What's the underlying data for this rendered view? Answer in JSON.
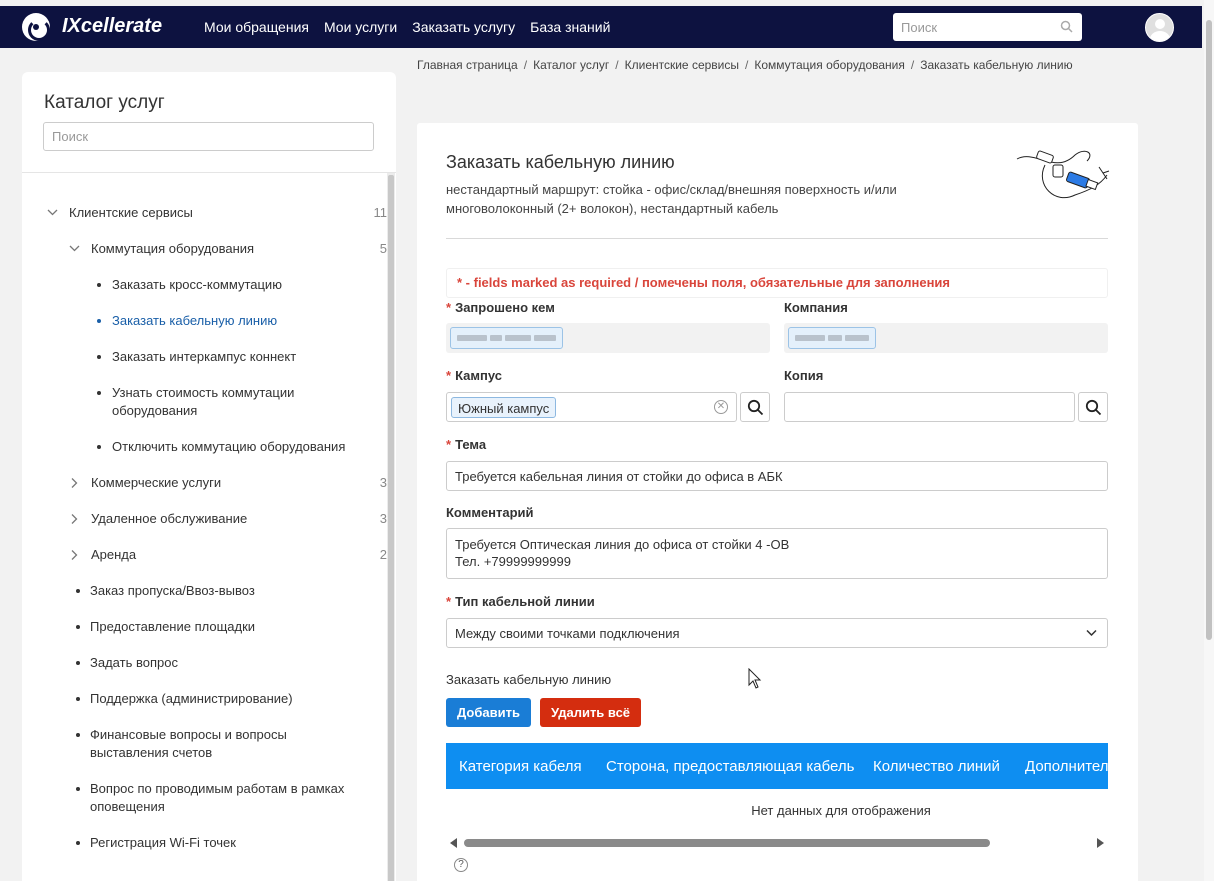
{
  "header": {
    "brand": "IXcellerate",
    "nav": [
      "Мои обращения",
      "Мои услуги",
      "Заказать услугу",
      "База знаний"
    ],
    "search_placeholder": "Поиск",
    "bg_color": "#0d1240"
  },
  "sidebar": {
    "title": "Каталог услуг",
    "search_placeholder": "Поиск",
    "tree": {
      "client_services": {
        "label": "Клиентские сервисы",
        "count": "11"
      },
      "commutation": {
        "label": "Коммутация оборудования",
        "count": "5"
      },
      "items": [
        "Заказать кросс-коммутацию",
        "Заказать кабельную линию",
        "Заказать интеркампус коннект",
        "Узнать стоимость коммутации оборудования",
        "Отключить коммутацию оборудования"
      ],
      "commercial": {
        "label": "Коммерческие услуги",
        "count": "3"
      },
      "remote": {
        "label": "Удаленное обслуживание",
        "count": "3"
      },
      "rent": {
        "label": "Аренда",
        "count": "2"
      },
      "leaves": [
        "Заказ пропуска/Ввоз-вывоз",
        "Предоставление площадки",
        "Задать вопрос",
        "Поддержка (администрирование)",
        "Финансовые вопросы и вопросы выставления счетов",
        "Вопрос по проводимым работам в рамках оповещения",
        "Регистрация Wi-Fi точек"
      ]
    }
  },
  "breadcrumb": [
    "Главная страница",
    "Каталог услуг",
    "Клиентские сервисы",
    "Коммутация оборудования",
    "Заказать кабельную линию"
  ],
  "form": {
    "title": "Заказать кабельную линию",
    "description": "нестандартный маршрут: стойка - офис/склад/внешняя поверхность и/или многоволоконный (2+ волокон), нестандартный кабель",
    "required_note": "* - fields marked as required / помечены поля, обязательные для заполнения",
    "requested_by_label": "Запрошено кем",
    "company_label": "Компания",
    "campus_label": "Кампус",
    "campus_value": "Южный кампус",
    "copy_label": "Копия",
    "topic_label": "Тема",
    "topic_value": "Требуется кабельная линия от стойки до офиса в АБК",
    "comment_label": "Комментарий",
    "comment_line1": "Требуется Оптическая линия до офиса от стойки 4 -ОВ",
    "comment_line2": "Тел. +79999999999",
    "cable_type_label": "Тип кабельной линии",
    "cable_type_value": "Между своими точками подключения",
    "section_label": "Заказать кабельную линию",
    "add_button": "Добавить",
    "delete_all_button": "Удалить всё",
    "grid_columns": [
      "Категория кабеля",
      "Сторона, предоставляющая кабель",
      "Количество линий",
      "Дополнител"
    ],
    "no_data": "Нет данных для отображения",
    "help": "?",
    "accent_blue": "#1a7dd6",
    "accent_red": "#d42d0f",
    "required_color": "#d9453b"
  }
}
